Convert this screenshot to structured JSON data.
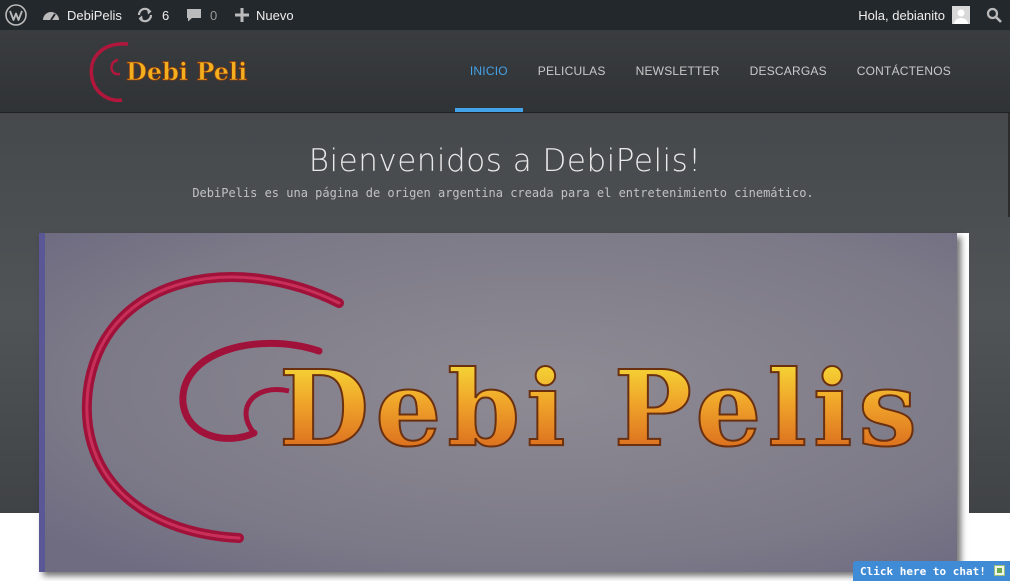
{
  "admin_bar": {
    "site_name": "DebiPelis",
    "updates_count": "6",
    "comments_count": "0",
    "new_label": "Nuevo",
    "greeting": "Hola, debianito"
  },
  "header": {
    "logo_text": "Debi Pelis",
    "nav": [
      {
        "label": "INICIO",
        "active": true
      },
      {
        "label": "PELICULAS"
      },
      {
        "label": "NEWSLETTER"
      },
      {
        "label": "DESCARGAS"
      },
      {
        "label": "CONTÁCTENOS"
      }
    ]
  },
  "hero": {
    "title": "Bienvenidos a DebiPelis!",
    "subtitle": "DebiPelis es una página de origen argentina creada para el entretenimiento cinemático.",
    "banner_text": "Debi Pelis"
  },
  "chat": {
    "label": "Click here to chat!"
  },
  "colors": {
    "admin_bar_bg": "#23282d",
    "accent": "#43a2e8",
    "header_bg": "#35383b",
    "chat_bg": "#3f8bd6",
    "logo_swirl": "#b3163c",
    "logo_fire": "#f2b01e"
  }
}
